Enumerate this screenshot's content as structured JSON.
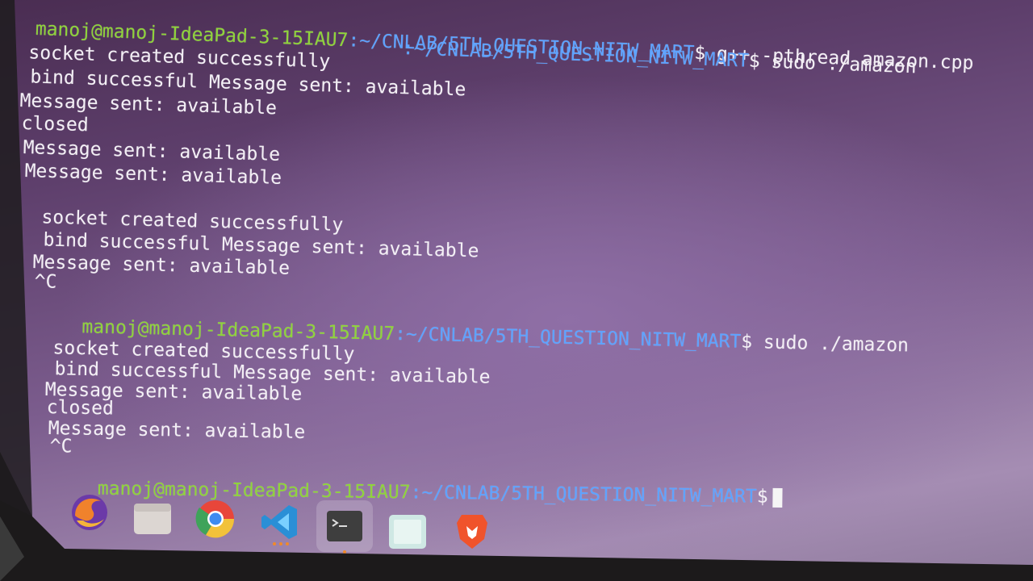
{
  "terminal": {
    "lines": [
      {
        "user": "manoj@manoj-IdeaPad-3-15IAU7",
        "path": ":~/CNLAB/5TH_QUESTION_NITW_MART",
        "cmd": "$ g++ -pthread amazon.cpp"
      },
      {
        "user": "",
        "path": ":~/CNLAB/5TH_QUESTION_NITW_MART",
        "cmd": "$ sudo ./amazon"
      },
      {
        "text": " socket created successfully"
      },
      {
        "text": " bind successful Message sent: available"
      },
      {
        "text": "Message sent: available"
      },
      {
        "text": "closed"
      },
      {
        "text": "Message sent: available"
      },
      {
        "text": "Message sent: available"
      },
      {
        "text": " socket created successfully"
      },
      {
        "text": " bind successful Message sent: available"
      },
      {
        "text": "Message sent: available"
      },
      {
        "text": "^C"
      },
      {
        "user": "manoj@manoj-IdeaPad-3-15IAU7",
        "path": ":~/CNLAB/5TH_QUESTION_NITW_MART",
        "cmd": "$ sudo ./amazon"
      },
      {
        "text": " socket created successfully"
      },
      {
        "text": " bind successful Message sent: available"
      },
      {
        "text": "Message sent: available"
      },
      {
        "text": "closed"
      },
      {
        "text": "Message sent: available"
      },
      {
        "text": "^C"
      },
      {
        "user": "manoj@manoj-IdeaPad-3-15IAU7",
        "path": ":~/CNLAB/5TH_QUESTION_NITW_MART",
        "cmd": "$"
      }
    ]
  },
  "dock": {
    "apps": [
      {
        "name": "firefox-icon",
        "color": "#e66a2c"
      },
      {
        "name": "files-icon",
        "color": "#d8d2cf"
      },
      {
        "name": "chrome-icon",
        "color": "#3fa35a"
      },
      {
        "name": "vscode-icon",
        "color": "#2fa3e6"
      },
      {
        "name": "terminal-icon",
        "color": "#4c4c4c"
      },
      {
        "name": "text-editor-icon",
        "color": "#cfe8e4"
      },
      {
        "name": "brave-icon",
        "color": "#f0532b"
      }
    ]
  }
}
